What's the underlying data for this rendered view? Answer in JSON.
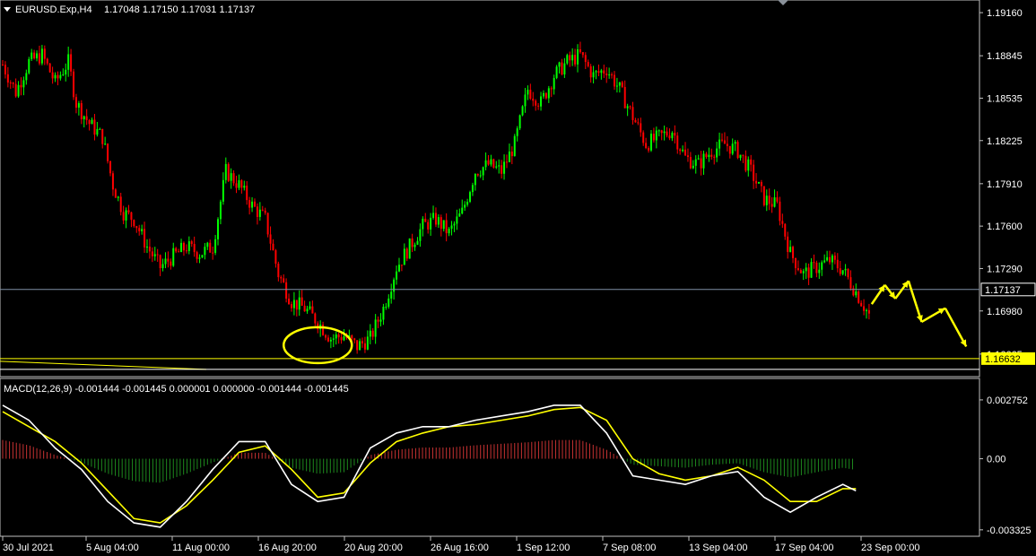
{
  "header": {
    "symbol": "EURUSD.Exp,H4",
    "ohlc": "1.17048 1.17150 1.17031 1.17137"
  },
  "macd_header": "MACD(12,26,9) -0.001444 -0.001445 0.000001 0.000000 -0.001444 -0.001445",
  "colors": {
    "background": "#000000",
    "bull": "#00ff00",
    "bear": "#ff0000",
    "macd_main": "#ffffff",
    "macd_signal": "#ffff00",
    "hist_positive": "#c83232",
    "hist_negative": "#1e8a1e",
    "annotation": "#ffff00",
    "current_price_line": "#7f8fa6",
    "axis": "#c0c0c0"
  },
  "chart_data": [
    {
      "type": "line",
      "name": "price",
      "price_labels": [
        "1.19160",
        "1.18845",
        "1.18535",
        "1.18225",
        "1.17910",
        "1.17600",
        "1.17290",
        "1.16980",
        "1.16665"
      ],
      "price_values": [
        1.1916,
        1.18845,
        1.18535,
        1.18225,
        1.1791,
        1.176,
        1.1729,
        1.1698,
        1.16665
      ],
      "current_price": "1.17137",
      "support_price": "1.16632",
      "ylim": [
        1.165,
        1.192
      ],
      "date_labels": [
        "30 Jul 2021",
        "5 Aug 04:00",
        "11 Aug 00:00",
        "16 Aug 20:00",
        "20 Aug 20:00",
        "26 Aug 16:00",
        "1 Sep 12:00",
        "7 Sep 08:00",
        "13 Sep 04:00",
        "17 Sep 04:00",
        "23 Sep 00:00"
      ],
      "close_path": [
        [
          0,
          1.1878
        ],
        [
          5,
          1.1858
        ],
        [
          10,
          1.188
        ],
        [
          15,
          1.1885
        ],
        [
          20,
          1.1865
        ],
        [
          25,
          1.188
        ],
        [
          28,
          1.185
        ],
        [
          33,
          1.1835
        ],
        [
          38,
          1.1825
        ],
        [
          42,
          1.179
        ],
        [
          46,
          1.177
        ],
        [
          50,
          1.1765
        ],
        [
          55,
          1.1745
        ],
        [
          60,
          1.173
        ],
        [
          65,
          1.1738
        ],
        [
          70,
          1.1745
        ],
        [
          75,
          1.174
        ],
        [
          80,
          1.1745
        ],
        [
          85,
          1.18
        ],
        [
          90,
          1.179
        ],
        [
          95,
          1.1775
        ],
        [
          100,
          1.1765
        ],
        [
          105,
          1.1725
        ],
        [
          110,
          1.1705
        ],
        [
          115,
          1.17
        ],
        [
          120,
          1.169
        ],
        [
          125,
          1.1678
        ],
        [
          130,
          1.168
        ],
        [
          135,
          1.1672
        ],
        [
          140,
          1.1678
        ],
        [
          145,
          1.17
        ],
        [
          150,
          1.173
        ],
        [
          155,
          1.1745
        ],
        [
          160,
          1.176
        ],
        [
          165,
          1.1765
        ],
        [
          170,
          1.1755
        ],
        [
          175,
          1.177
        ],
        [
          180,
          1.18
        ],
        [
          185,
          1.1805
        ],
        [
          190,
          1.18
        ],
        [
          195,
          1.182
        ],
        [
          200,
          1.186
        ],
        [
          205,
          1.185
        ],
        [
          210,
          1.187
        ],
        [
          215,
          1.188
        ],
        [
          220,
          1.1885
        ],
        [
          225,
          1.187
        ],
        [
          230,
          1.1875
        ],
        [
          235,
          1.186
        ],
        [
          240,
          1.184
        ],
        [
          245,
          1.182
        ],
        [
          250,
          1.1825
        ],
        [
          255,
          1.183
        ],
        [
          260,
          1.181
        ],
        [
          265,
          1.1805
        ],
        [
          270,
          1.1815
        ],
        [
          275,
          1.182
        ],
        [
          280,
          1.1815
        ],
        [
          285,
          1.18
        ],
        [
          290,
          1.178
        ],
        [
          295,
          1.1775
        ],
        [
          300,
          1.174
        ],
        [
          305,
          1.1725
        ],
        [
          310,
          1.173
        ],
        [
          315,
          1.1735
        ],
        [
          320,
          1.1728
        ],
        [
          325,
          1.1712
        ],
        [
          330,
          1.1695
        ]
      ],
      "annotations": {
        "circle_center": [
          120,
          1.1673
        ],
        "zigzag_path": [
          [
            331,
            1.1703
          ],
          [
            336,
            1.1717
          ],
          [
            340,
            1.1707
          ],
          [
            345,
            1.172
          ],
          [
            350,
            1.169
          ],
          [
            359,
            1.17
          ],
          [
            367,
            1.1672
          ]
        ]
      }
    },
    {
      "type": "line",
      "name": "MACD(12,26,9)",
      "y_labels": [
        "0.002752",
        "0.00",
        "-0.003325"
      ],
      "ylim": [
        -0.0035,
        0.003
      ],
      "macd_main": [
        [
          0,
          0.0025
        ],
        [
          10,
          0.0018
        ],
        [
          20,
          0.0005
        ],
        [
          30,
          -0.0005
        ],
        [
          40,
          -0.002
        ],
        [
          50,
          -0.003
        ],
        [
          60,
          -0.0032
        ],
        [
          70,
          -0.002
        ],
        [
          80,
          -0.0005
        ],
        [
          90,
          0.0008
        ],
        [
          100,
          0.0008
        ],
        [
          110,
          -0.0012
        ],
        [
          120,
          -0.002
        ],
        [
          130,
          -0.0018
        ],
        [
          140,
          0.0005
        ],
        [
          150,
          0.0012
        ],
        [
          160,
          0.0015
        ],
        [
          170,
          0.0015
        ],
        [
          180,
          0.0018
        ],
        [
          190,
          0.002
        ],
        [
          200,
          0.0022
        ],
        [
          210,
          0.0025
        ],
        [
          220,
          0.0025
        ],
        [
          230,
          0.0012
        ],
        [
          240,
          -0.0008
        ],
        [
          250,
          -0.001
        ],
        [
          260,
          -0.0012
        ],
        [
          270,
          -0.0008
        ],
        [
          280,
          -0.0006
        ],
        [
          290,
          -0.0018
        ],
        [
          300,
          -0.0025
        ],
        [
          310,
          -0.0018
        ],
        [
          320,
          -0.0012
        ],
        [
          325,
          -0.0015
        ]
      ],
      "macd_signal": [
        [
          0,
          0.0022
        ],
        [
          10,
          0.0015
        ],
        [
          20,
          0.0008
        ],
        [
          30,
          -0.0002
        ],
        [
          40,
          -0.0015
        ],
        [
          50,
          -0.0028
        ],
        [
          60,
          -0.003
        ],
        [
          70,
          -0.0022
        ],
        [
          80,
          -0.001
        ],
        [
          90,
          0.0003
        ],
        [
          100,
          0.0006
        ],
        [
          110,
          -0.0005
        ],
        [
          120,
          -0.0018
        ],
        [
          130,
          -0.0016
        ],
        [
          140,
          -0.0002
        ],
        [
          150,
          0.0008
        ],
        [
          160,
          0.0012
        ],
        [
          170,
          0.0015
        ],
        [
          180,
          0.0016
        ],
        [
          190,
          0.0018
        ],
        [
          200,
          0.002
        ],
        [
          210,
          0.0023
        ],
        [
          220,
          0.0024
        ],
        [
          230,
          0.0018
        ],
        [
          240,
          0.0
        ],
        [
          250,
          -0.0007
        ],
        [
          260,
          -0.001
        ],
        [
          270,
          -0.0008
        ],
        [
          280,
          -0.0004
        ],
        [
          290,
          -0.001
        ],
        [
          300,
          -0.002
        ],
        [
          310,
          -0.002
        ],
        [
          320,
          -0.0014
        ],
        [
          325,
          -0.0014
        ]
      ]
    }
  ]
}
